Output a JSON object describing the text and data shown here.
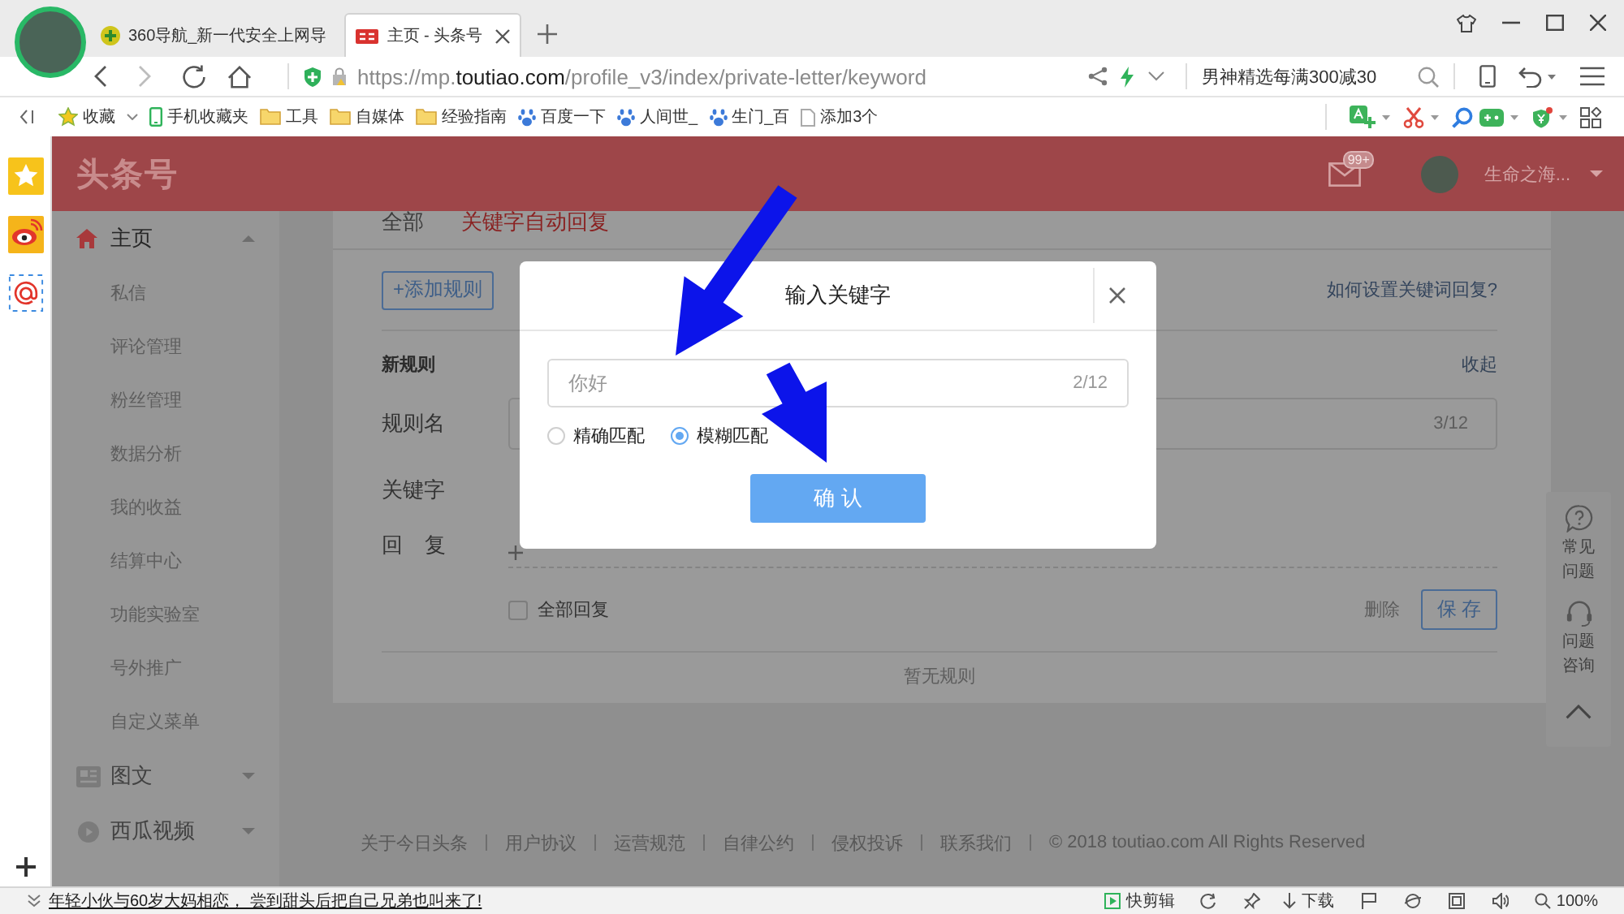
{
  "browser": {
    "tabs": [
      {
        "title": "360导航_新一代安全上网导",
        "selected": false
      },
      {
        "title": "主页 - 头条号",
        "selected": true
      }
    ],
    "url": "https://mp.**toutiao.com**/profile_v3/index/private-letter/keyword",
    "search_box": {
      "value": "男神精选每满300减30"
    },
    "bookmarks": [
      {
        "label": "收藏",
        "kind": "favorites"
      },
      {
        "label": "手机收藏夹",
        "kind": "phone"
      },
      {
        "label": "工具",
        "kind": "folder"
      },
      {
        "label": "自媒体",
        "kind": "folder"
      },
      {
        "label": "经验指南",
        "kind": "folder"
      },
      {
        "label": "百度一下",
        "kind": "paw"
      },
      {
        "label": "人间世_",
        "kind": "paw"
      },
      {
        "label": "生门_百",
        "kind": "paw"
      },
      {
        "label": "添加3个",
        "kind": "page"
      }
    ]
  },
  "site": {
    "logo": "头条号",
    "mail_badge": "99+",
    "user_name": "生命之海...",
    "nav": [
      {
        "label": "主页",
        "selected": true,
        "expanded": true,
        "children": [
          {
            "label": "私信"
          },
          {
            "label": "评论管理"
          },
          {
            "label": "粉丝管理"
          },
          {
            "label": "数据分析"
          },
          {
            "label": "我的收益"
          },
          {
            "label": "结算中心"
          },
          {
            "label": "功能实验室"
          },
          {
            "label": "号外推广"
          },
          {
            "label": "自定义菜单"
          }
        ]
      },
      {
        "label": "图文",
        "selected": false,
        "expanded": false
      },
      {
        "label": "西瓜视频",
        "selected": false,
        "expanded": false
      }
    ],
    "content_tabs": [
      {
        "label": "全部",
        "selected": false
      },
      {
        "label": "关键字自动回复",
        "selected": true
      }
    ],
    "add_rule_button": "+添加规则",
    "help_link": "如何设置关键词回复?",
    "rule_form": {
      "heading": "新规则",
      "collapse_link": "收起",
      "name_label": "规则名",
      "name_counter": "3/12",
      "keyword_label": "关键字",
      "reply_label": "回 复",
      "all_reply": {
        "label": "全部回复",
        "checked": false
      },
      "delete_link": "删除",
      "save_button": "保 存"
    },
    "empty_text": "暂无规则",
    "footer": {
      "links": [
        "关于今日头条",
        "用户协议",
        "运营规范",
        "自律公约",
        "侵权投诉",
        "联系我们"
      ],
      "copyright": "© 2018 toutiao.com All Rights Reserved"
    },
    "help_float": [
      {
        "label": "常见问题"
      },
      {
        "label": "问题咨询"
      }
    ]
  },
  "modal": {
    "title": "输入关键字",
    "input": {
      "value": "你好",
      "counter": "2/12"
    },
    "match_options": [
      {
        "label": "精确匹配",
        "selected": false
      },
      {
        "label": "模糊匹配",
        "selected": true
      }
    ],
    "confirm_button": "确 认"
  },
  "status_bar": {
    "news": "年轻小伙与60岁大妈相恋， 尝到甜头后把自己兄弟也叫来了!",
    "clip_tool": "快剪辑",
    "download": "下载",
    "zoom": "100%"
  }
}
